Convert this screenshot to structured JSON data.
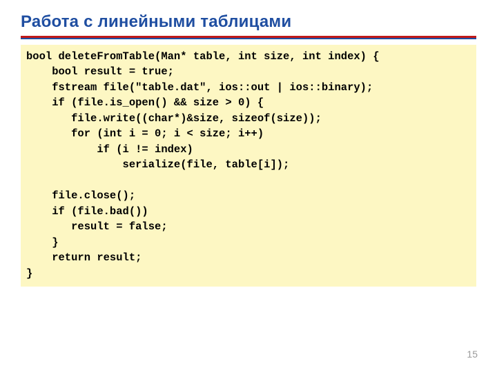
{
  "title": "Работа с линейными таблицами",
  "code": "bool deleteFromTable(Man* table, int size, int index) {\n    bool result = true;\n    fstream file(\"table.dat\", ios::out | ios::binary);\n    if (file.is_open() && size > 0) {\n       file.write((char*)&size, sizeof(size));\n       for (int i = 0; i < size; i++)\n           if (i != index)\n               serialize(file, table[i]);\n\n    file.close();\n    if (file.bad())\n       result = false;\n    }\n    return result;\n}",
  "page_number": "15"
}
